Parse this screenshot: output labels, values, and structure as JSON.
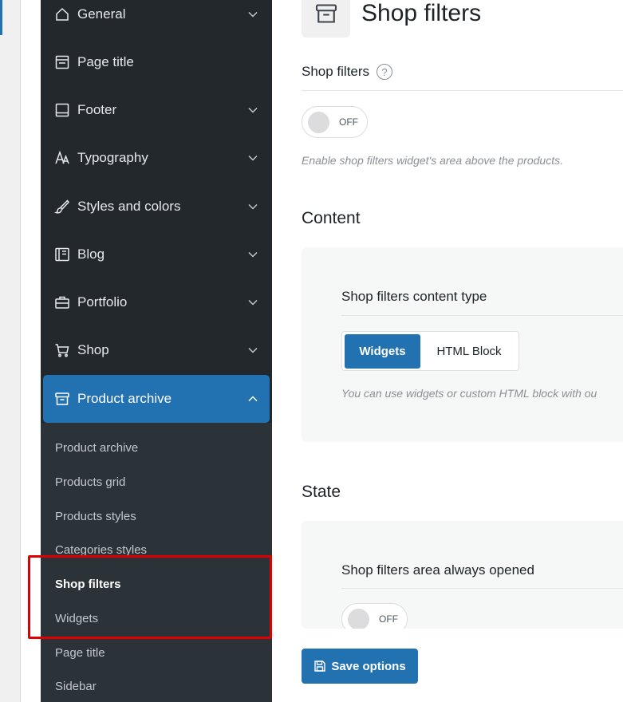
{
  "sidebar": {
    "items": [
      {
        "label": "General",
        "icon": "home-icon",
        "expanded": false
      },
      {
        "label": "Page title",
        "icon": "page-title-icon",
        "expanded": false
      },
      {
        "label": "Footer",
        "icon": "footer-icon",
        "expanded": false
      },
      {
        "label": "Typography",
        "icon": "typography-icon",
        "expanded": false
      },
      {
        "label": "Styles and colors",
        "icon": "brush-icon",
        "expanded": false
      },
      {
        "label": "Blog",
        "icon": "blog-icon",
        "expanded": false
      },
      {
        "label": "Portfolio",
        "icon": "briefcase-icon",
        "expanded": false
      },
      {
        "label": "Shop",
        "icon": "cart-icon",
        "expanded": false
      },
      {
        "label": "Product archive",
        "icon": "archive-icon",
        "expanded": true
      }
    ],
    "subitems": [
      {
        "label": "Product archive",
        "current": false
      },
      {
        "label": "Products grid",
        "current": false
      },
      {
        "label": "Products styles",
        "current": false
      },
      {
        "label": "Categories styles",
        "current": false
      },
      {
        "label": "Shop filters",
        "current": true
      },
      {
        "label": "Widgets",
        "current": false
      },
      {
        "label": "Page title",
        "current": false
      },
      {
        "label": "Sidebar",
        "current": false
      }
    ]
  },
  "main": {
    "page_title": "Shop filters",
    "shop_filters": {
      "label": "Shop filters",
      "help": "?",
      "toggle_text": "OFF",
      "description": "Enable shop filters widget's area above the products."
    },
    "content": {
      "heading": "Content",
      "field_label": "Shop filters content type",
      "options": [
        "Widgets",
        "HTML Block"
      ],
      "selected": "Widgets",
      "description": "You can use widgets or custom HTML block with ou"
    },
    "state": {
      "heading": "State",
      "field_label": "Shop filters area always opened",
      "toggle_text": "OFF"
    },
    "save_label": "Save options"
  },
  "colors": {
    "accent": "#2271b1",
    "sidebar_bg": "#23282d",
    "submenu_bg": "#2c3338",
    "highlight": "#e00000"
  }
}
